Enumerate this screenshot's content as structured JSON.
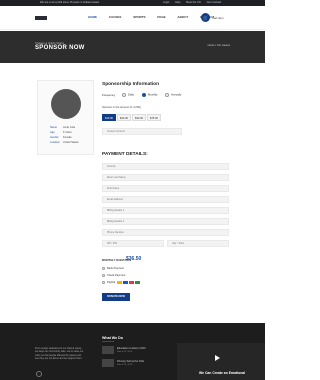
{
  "topbar": {
    "left_text": "We are a non-profit since 15 years in Indiana states",
    "links": [
      "Login",
      "Help",
      "Meet the CO",
      "Get involved"
    ]
  },
  "nav": {
    "items": [
      "HOME",
      "CAUSES",
      "SPORTS",
      "PAGE",
      "ABOUT",
      "CONTACT"
    ],
    "active_index": 0,
    "cart_label": "Cart Item",
    "cart_icon": "cart-icon"
  },
  "hero": {
    "pre_title": "Change a child's World",
    "title": "SPONSOR NOW",
    "breadcrumb": "Home / Our causes"
  },
  "profile": {
    "rows": [
      {
        "key": "Name",
        "value": "Amar Cole"
      },
      {
        "key": "Age",
        "value": "6 Years"
      },
      {
        "key": "Gender",
        "value": "Female"
      },
      {
        "key": "Location",
        "value": "United States"
      }
    ]
  },
  "sponsorship": {
    "title": "Sponsorship Information",
    "frequency_label": "Frequency",
    "options": [
      "Daily",
      "Monthly",
      "Annually"
    ],
    "selected_option": 1,
    "amount_label": "Sponsor in the amount of: (USD)",
    "amounts": [
      "$10.00",
      "$20.00",
      "$30.00",
      "$75.00"
    ],
    "selected_amount": 0,
    "custom_amount_placeholder": "Custom Amount"
  },
  "payment": {
    "title": "PAYMENT DETAILS:",
    "fields": [
      "Country",
      "Enter Last Name",
      "First Name",
      "Email address",
      "Billing Details 1",
      "Billing Details 2",
      "Phone Number",
      "ZIP / PIN"
    ],
    "city_placeholder": "City / Town"
  },
  "total": {
    "label": "MONTHLY DONATION",
    "value": "$36.50"
  },
  "methods": {
    "items": [
      "Bank Payment",
      "Check Payment",
      "PayPal"
    ],
    "card_colors": [
      "#f4b400",
      "#1a58c7",
      "#e0393e",
      "#2c8f3d"
    ]
  },
  "donate_button": "DONATE NOW",
  "footer": {
    "about_text": "From people dedicated to our shared cause, we keep our community safe. Let us raise our voice so that people affected by causes will see they are not alone and we support them.",
    "heading": "What We Do",
    "items": [
      {
        "title": "Education to Every Child",
        "date": "March 24, 2016"
      },
      {
        "title": "Primary School for Kids",
        "date": "March 24, 2016"
      }
    ],
    "promo_text": "We Can Create an Emotional"
  }
}
